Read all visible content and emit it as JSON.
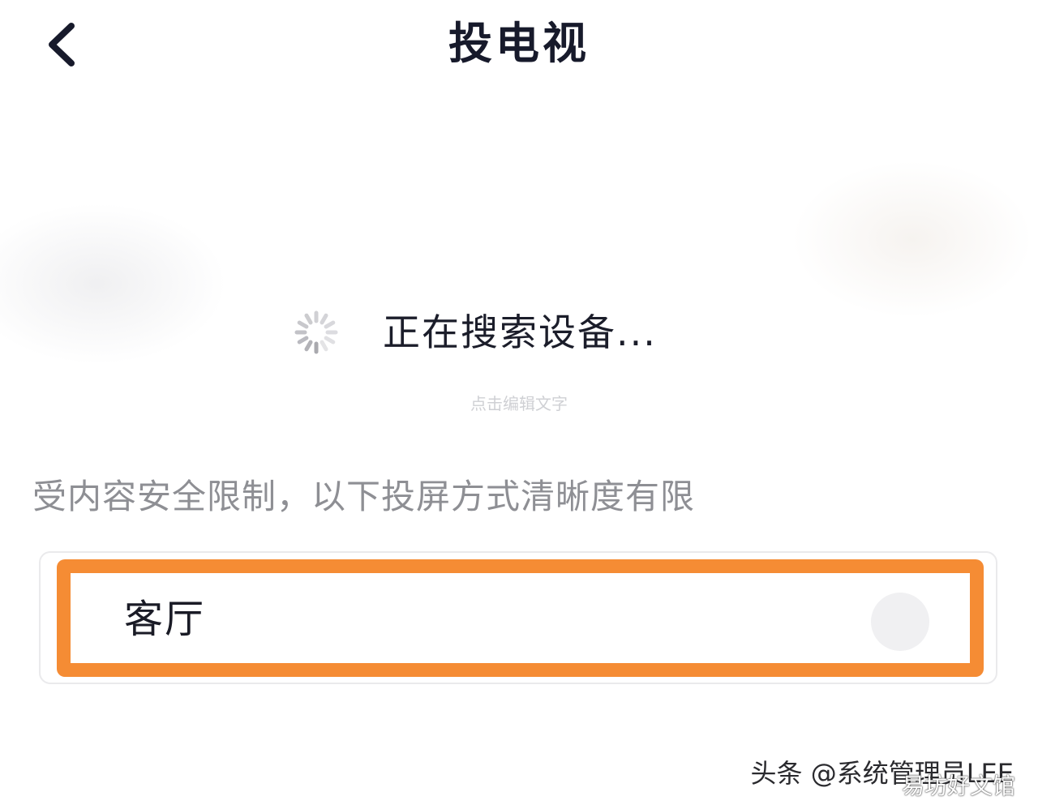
{
  "header": {
    "title": "投电视",
    "back_icon": "chevron-left-icon"
  },
  "search": {
    "status": "正在搜索设备...",
    "spinner_icon": "loading-spinner-icon",
    "edit_hint": "点击编辑文字"
  },
  "notice": "受内容安全限制，以下投屏方式清晰度有限",
  "devices": [
    {
      "name": "客厅",
      "selected": false
    }
  ],
  "watermark": {
    "text": "头条 @系统管理员LEE",
    "overlay": "易坊好文馆"
  },
  "colors": {
    "highlight": "#f58c34",
    "title": "#171a2b",
    "notice": "#8e8f94"
  }
}
